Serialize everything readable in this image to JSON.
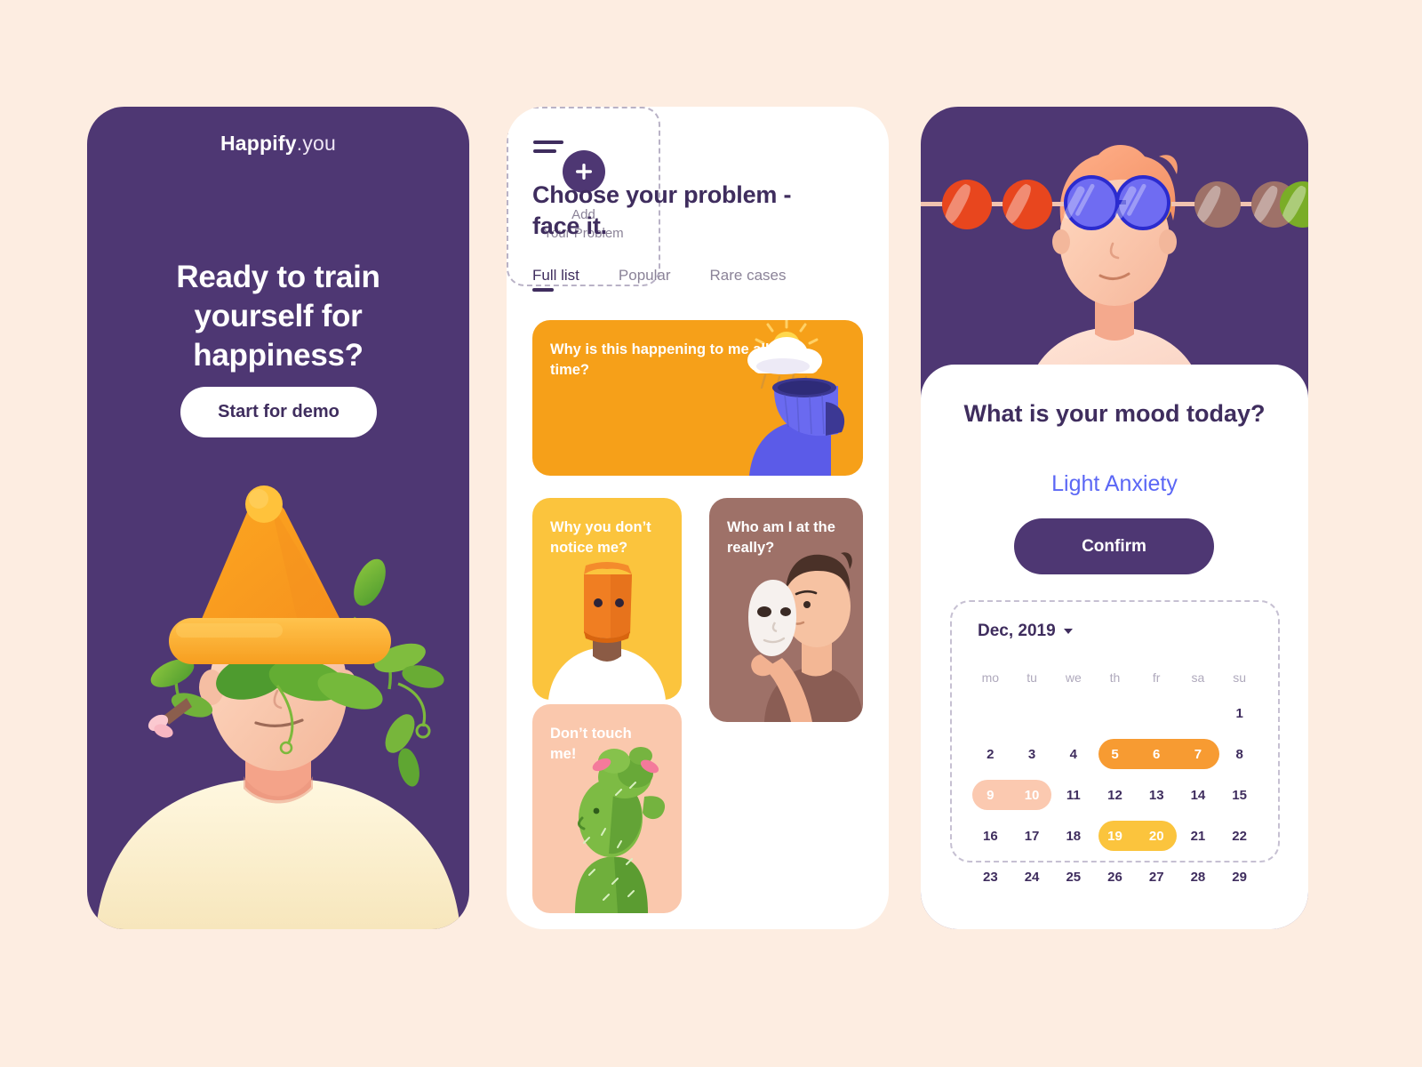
{
  "palette": {
    "background": "#FDEDE1",
    "purple": "#4E3773",
    "purple_text": "#3F2D5E",
    "white": "#FFFFFF",
    "orange": "#F6A019",
    "yellow": "#FBC43D",
    "mauve": "#9E7168",
    "peach": "#FAC8AD",
    "periwinkle": "#5B67F5",
    "muted": "#8B8398",
    "cream_shirt": "#FAEFCE"
  },
  "screen_intro": {
    "brand_name": "Happify",
    "brand_suffix": ".you",
    "headline": "Ready to train yourself for happiness?",
    "cta_label": "Start for demo",
    "illustration": "person-with-orange-beanie-and-plants"
  },
  "screen_problems": {
    "menu_icon": "hamburger-icon",
    "title": "Choose your problem - face it.",
    "tabs": [
      {
        "label": "Full list",
        "active": true
      },
      {
        "label": "Popular",
        "active": false
      },
      {
        "label": "Rare cases",
        "active": false
      }
    ],
    "cards": [
      {
        "id": "wide",
        "text": "Why is this happening to me all the time?",
        "color": "#F6A019",
        "illustration": "person-with-open-head-rain-cloud"
      },
      {
        "id": "yellow",
        "text": "Why you don’t notice me?",
        "color": "#FBC43D",
        "illustration": "person-with-paper-bag-on-head"
      },
      {
        "id": "mauve",
        "text": "Who am I at the really?",
        "color": "#9E7168",
        "illustration": "person-holding-white-mask"
      },
      {
        "id": "peach",
        "text": "Don’t touch me!",
        "color": "#FAC8AD",
        "illustration": "cactus-person"
      }
    ],
    "add_card": {
      "icon": "plus-icon",
      "line1": "Add",
      "line2": "Your Problem"
    }
  },
  "screen_mood": {
    "illustration": "person-with-round-blue-sunglasses-abacus",
    "beads": [
      "#E8461E",
      "#E8461E",
      "#F0A93A",
      "#F0A93A",
      "#9E7168",
      "#9E7168",
      "#7AAD27"
    ],
    "question": "What is your mood today?",
    "selected_mood": "Light Anxiety",
    "confirm_label": "Confirm",
    "calendar": {
      "month_label": "Dec, 2019",
      "dropdown_icon": "chevron-down-icon",
      "weekdays": [
        "mo",
        "tu",
        "we",
        "th",
        "fr",
        "sa",
        "su"
      ],
      "weeks": [
        [
          "",
          "",
          "",
          "",
          "",
          "",
          "1"
        ],
        [
          "2",
          "3",
          "4",
          "5",
          "6",
          "7",
          "8"
        ],
        [
          "9",
          "10",
          "11",
          "12",
          "13",
          "14",
          "15"
        ],
        [
          "16",
          "17",
          "18",
          "19",
          "20",
          "21",
          "22"
        ],
        [
          "23",
          "24",
          "25",
          "26",
          "27",
          "28",
          "29"
        ]
      ],
      "highlights": [
        {
          "week": 1,
          "start": 3,
          "end": 5,
          "color": "#F79B32",
          "days": "5-7"
        },
        {
          "week": 2,
          "start": 0,
          "end": 1,
          "color": "#FBC9B0",
          "days": "9-10"
        },
        {
          "week": 3,
          "start": 3,
          "end": 4,
          "color": "#FBC43D",
          "days": "19-20"
        }
      ]
    }
  }
}
